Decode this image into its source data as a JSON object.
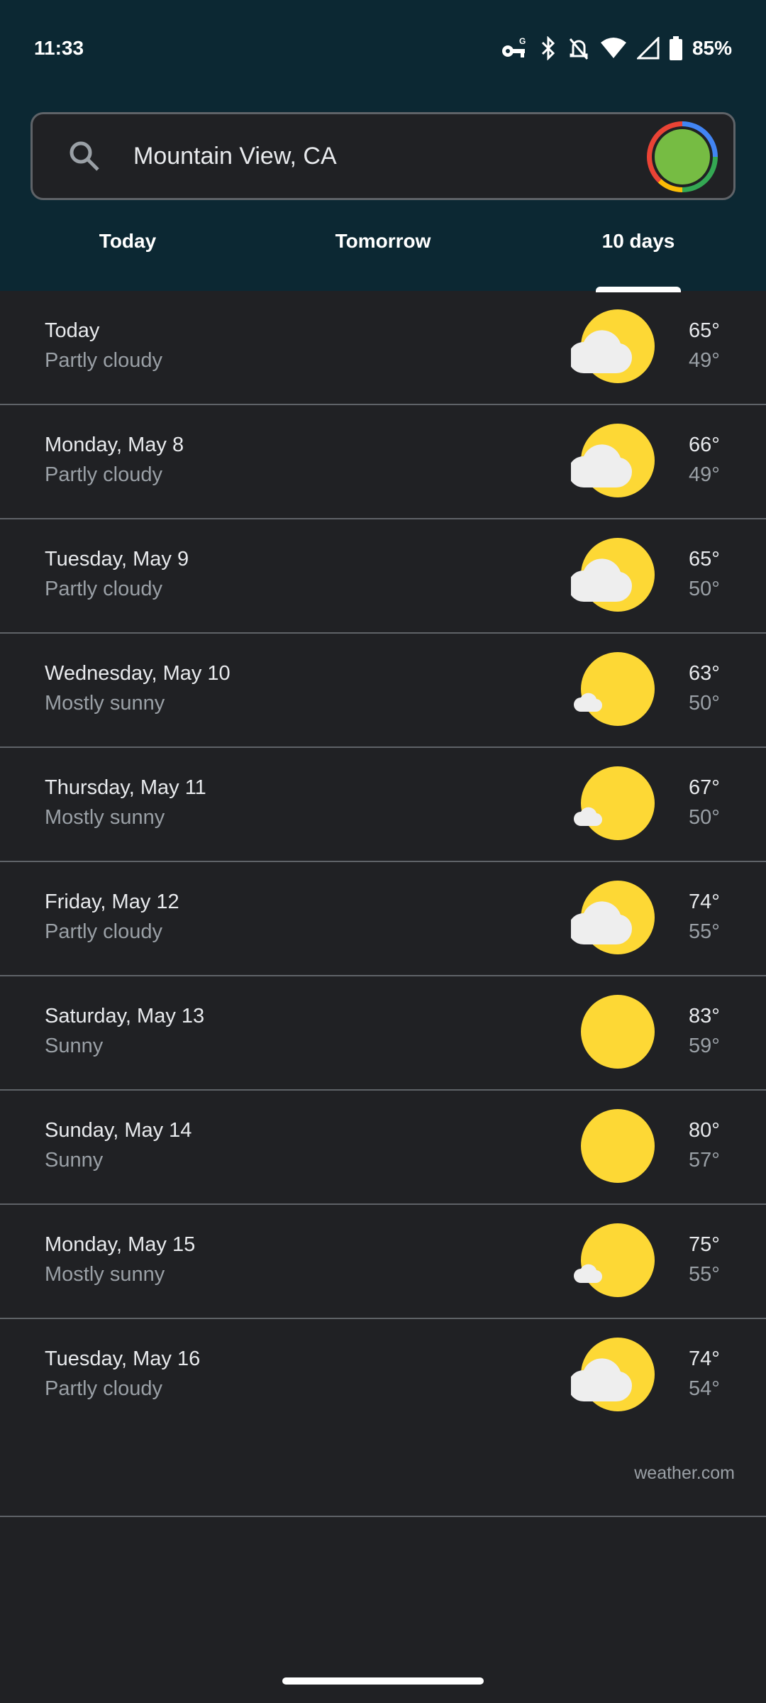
{
  "status_bar": {
    "time": "11:33",
    "battery": "85%",
    "icons": [
      "vpn-key-icon",
      "bluetooth-icon",
      "notifications-off-icon",
      "wifi-icon",
      "cellular-signal-icon",
      "battery-icon"
    ]
  },
  "search": {
    "value": "Mountain View, CA",
    "icon": "search-icon"
  },
  "tabs": [
    {
      "label": "Today"
    },
    {
      "label": "Tomorrow"
    },
    {
      "label": "10 days",
      "active": true
    }
  ],
  "forecast": [
    {
      "day": "Today",
      "condition": "Partly cloudy",
      "high": "65°",
      "low": "49°",
      "icon": "partly-cloudy"
    },
    {
      "day": "Monday, May 8",
      "condition": "Partly cloudy",
      "high": "66°",
      "low": "49°",
      "icon": "partly-cloudy"
    },
    {
      "day": "Tuesday, May 9",
      "condition": "Partly cloudy",
      "high": "65°",
      "low": "50°",
      "icon": "partly-cloudy"
    },
    {
      "day": "Wednesday, May 10",
      "condition": "Mostly sunny",
      "high": "63°",
      "low": "50°",
      "icon": "mostly-sunny"
    },
    {
      "day": "Thursday, May 11",
      "condition": "Mostly sunny",
      "high": "67°",
      "low": "50°",
      "icon": "mostly-sunny"
    },
    {
      "day": "Friday, May 12",
      "condition": "Partly cloudy",
      "high": "74°",
      "low": "55°",
      "icon": "partly-cloudy"
    },
    {
      "day": "Saturday, May 13",
      "condition": "Sunny",
      "high": "83°",
      "low": "59°",
      "icon": "sunny"
    },
    {
      "day": "Sunday, May 14",
      "condition": "Sunny",
      "high": "80°",
      "low": "57°",
      "icon": "sunny"
    },
    {
      "day": "Monday, May 15",
      "condition": "Mostly sunny",
      "high": "75°",
      "low": "55°",
      "icon": "mostly-sunny"
    },
    {
      "day": "Tuesday, May 16",
      "condition": "Partly cloudy",
      "high": "74°",
      "low": "54°",
      "icon": "partly-cloudy"
    }
  ],
  "source": "weather.com",
  "colors": {
    "header_bg": "#0c2833",
    "body_bg": "#202124",
    "sun": "#fdd835",
    "cloud": "#eeeeee"
  }
}
